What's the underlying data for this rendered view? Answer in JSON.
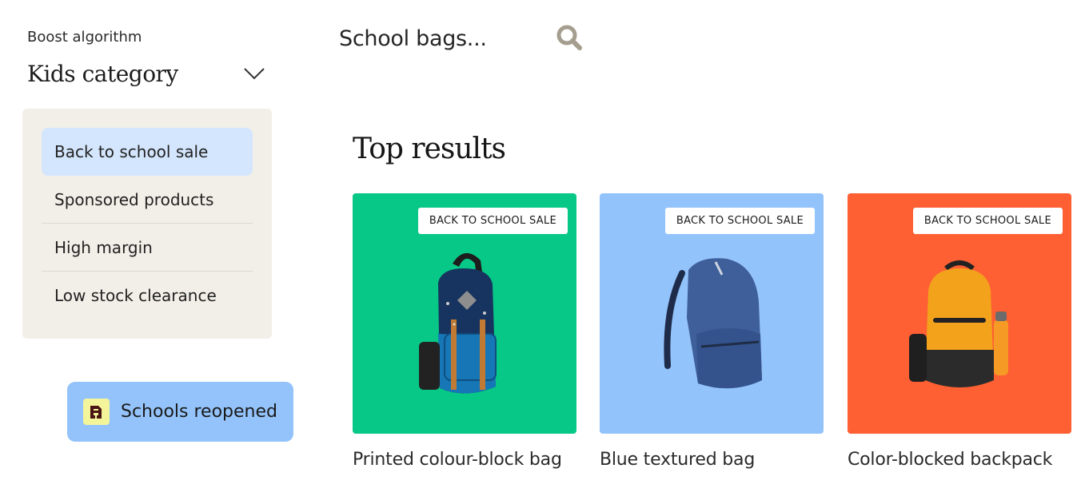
{
  "boost": {
    "label": "Boost algorithm",
    "selected_category": "Kids category"
  },
  "algorithms": [
    {
      "label": "Back to school sale",
      "active": true
    },
    {
      "label": "Sponsored products",
      "active": false
    },
    {
      "label": "High margin",
      "active": false
    },
    {
      "label": "Low stock clearance",
      "active": false
    }
  ],
  "event_chip": {
    "label": "Schools reopened",
    "icon": "school-building-icon"
  },
  "search": {
    "value": "School bags...",
    "icon": "search-icon"
  },
  "results": {
    "title": "Top results",
    "products": [
      {
        "name": "Printed colour-block bag",
        "tag": "BACK TO SCHOOL SALE",
        "bg": "#07c886"
      },
      {
        "name": "Blue textured bag",
        "tag": "BACK TO SCHOOL SALE",
        "bg": "#93c3fb"
      },
      {
        "name": "Color-blocked backpack",
        "tag": "BACK TO SCHOOL SALE",
        "bg": "#fe5f33"
      }
    ]
  },
  "colors": {
    "panel_bg": "#f2efe8",
    "active_item": "#d3e6fd",
    "chip_bg": "#93c3fa",
    "chip_icon_bg": "#f4f59a"
  }
}
